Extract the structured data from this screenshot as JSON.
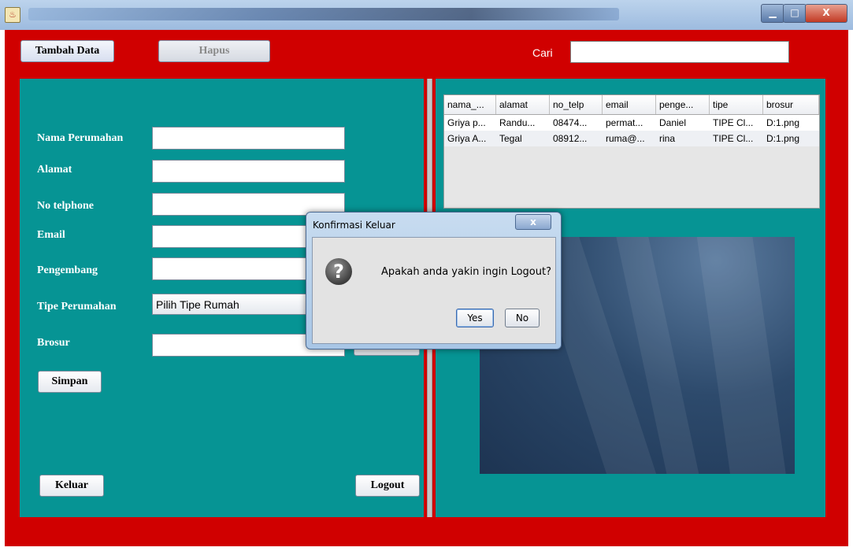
{
  "window": {
    "title": "",
    "icon": "java-coffee-icon",
    "controls": {
      "minimize": "▁",
      "maximize": "□",
      "close": "X"
    }
  },
  "toolbar": {
    "tambah_label": "Tambah Data",
    "hapus_label": "Hapus",
    "cari_label": "Cari",
    "cari_value": ""
  },
  "form": {
    "fields": [
      {
        "label": "Nama Perumahan",
        "value": ""
      },
      {
        "label": "Alamat",
        "value": ""
      },
      {
        "label": "No telphone",
        "value": ""
      },
      {
        "label": "Email",
        "value": ""
      },
      {
        "label": "Pengembang",
        "value": ""
      },
      {
        "label": "Tipe Perumahan",
        "value": "Pilih Tipe Rumah"
      },
      {
        "label": "Brosur",
        "value": ""
      }
    ],
    "simpan_label": "Simpan",
    "keluar_label": "Keluar",
    "logout_label": "Logout"
  },
  "table": {
    "columns": [
      "nama_...",
      "alamat",
      "no_telp",
      "email",
      "penge...",
      "tipe",
      "brosur"
    ],
    "rows": [
      [
        "Griya p...",
        "Randu...",
        "08474...",
        "permat...",
        "Daniel",
        "TIPE Cl...",
        "D:1.png"
      ],
      [
        "Griya A...",
        "Tegal",
        "08912...",
        "ruma@...",
        "rina",
        "TIPE Cl...",
        "D:1.png"
      ]
    ]
  },
  "dialog": {
    "title": "Konfirmasi Keluar",
    "close": "x",
    "icon": "question-icon",
    "icon_glyph": "?",
    "message": "Apakah anda yakin ingin Logout?",
    "yes_label": "Yes",
    "no_label": "No"
  },
  "colors": {
    "frame": "#d00000",
    "panel": "#069494",
    "dialog_frame": "#b8d2ee"
  }
}
